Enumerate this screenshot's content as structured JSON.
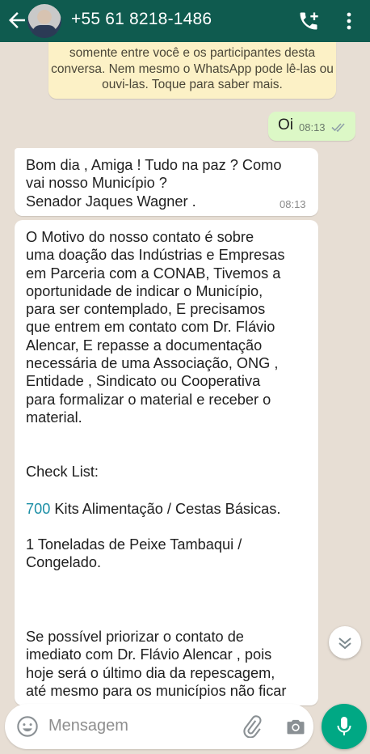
{
  "header": {
    "contact_name": "+55 61 8218-1486"
  },
  "system_notice": {
    "lines": [
      "somente entre você e os participantes desta",
      "conversa. Nem mesmo o WhatsApp pode lê-las ou",
      "ouvi-las. Toque para saber mais."
    ]
  },
  "messages": [
    {
      "direction": "out",
      "text": "Oi",
      "time": "08:13",
      "status": "read"
    },
    {
      "direction": "in",
      "lines": [
        "Bom dia , Amiga ! Tudo na paz ? Como",
        "vai nosso Município ?",
        "Senador Jaques Wagner ."
      ],
      "time": "08:13"
    },
    {
      "direction": "in",
      "lines": [
        "O Motivo do nosso contato é sobre",
        "uma doação das Indústrias e Empresas",
        "em Parceria com a CONAB, Tivemos a",
        "oportunidade  de  indicar o Município,",
        "para ser contemplado, E precisamos",
        "que entrem em contato com Dr. Flávio",
        "Alencar, E repasse a documentação",
        "necessária de uma Associação,  ONG ,",
        "Entidade , Sindicato ou Cooperativa",
        "para formalizar o material e receber o",
        "material."
      ],
      "checklist_title": "Check List:",
      "item1_number": "700",
      "item1_text": " Kits Alimentação / Cestas Básicas.",
      "item2_lines": [
        "1 Toneladas de Peixe Tambaqui  /",
        "Congelado."
      ],
      "closing_lines": [
        "Se possível priorizar o contato de",
        "imediato com Dr. Flávio Alencar , pois",
        "hoje será o último dia da repescagem,",
        "até mesmo para os municípios não ficar"
      ]
    }
  ],
  "composer": {
    "placeholder": "Mensagem"
  },
  "colors": {
    "header": "#0f5b4f",
    "chat_background": "#e7ded4",
    "outgoing_bubble": "#dcf8c6",
    "system_notice": "#fcf1c6",
    "accent": "#00a884",
    "link": "#1c8fa6"
  },
  "icons": [
    "back-arrow-icon",
    "avatar",
    "add-call-icon",
    "more-vert-icon",
    "read-ticks-icon",
    "scroll-down-icon",
    "emoji-icon",
    "attach-icon",
    "camera-icon",
    "mic-icon"
  ]
}
